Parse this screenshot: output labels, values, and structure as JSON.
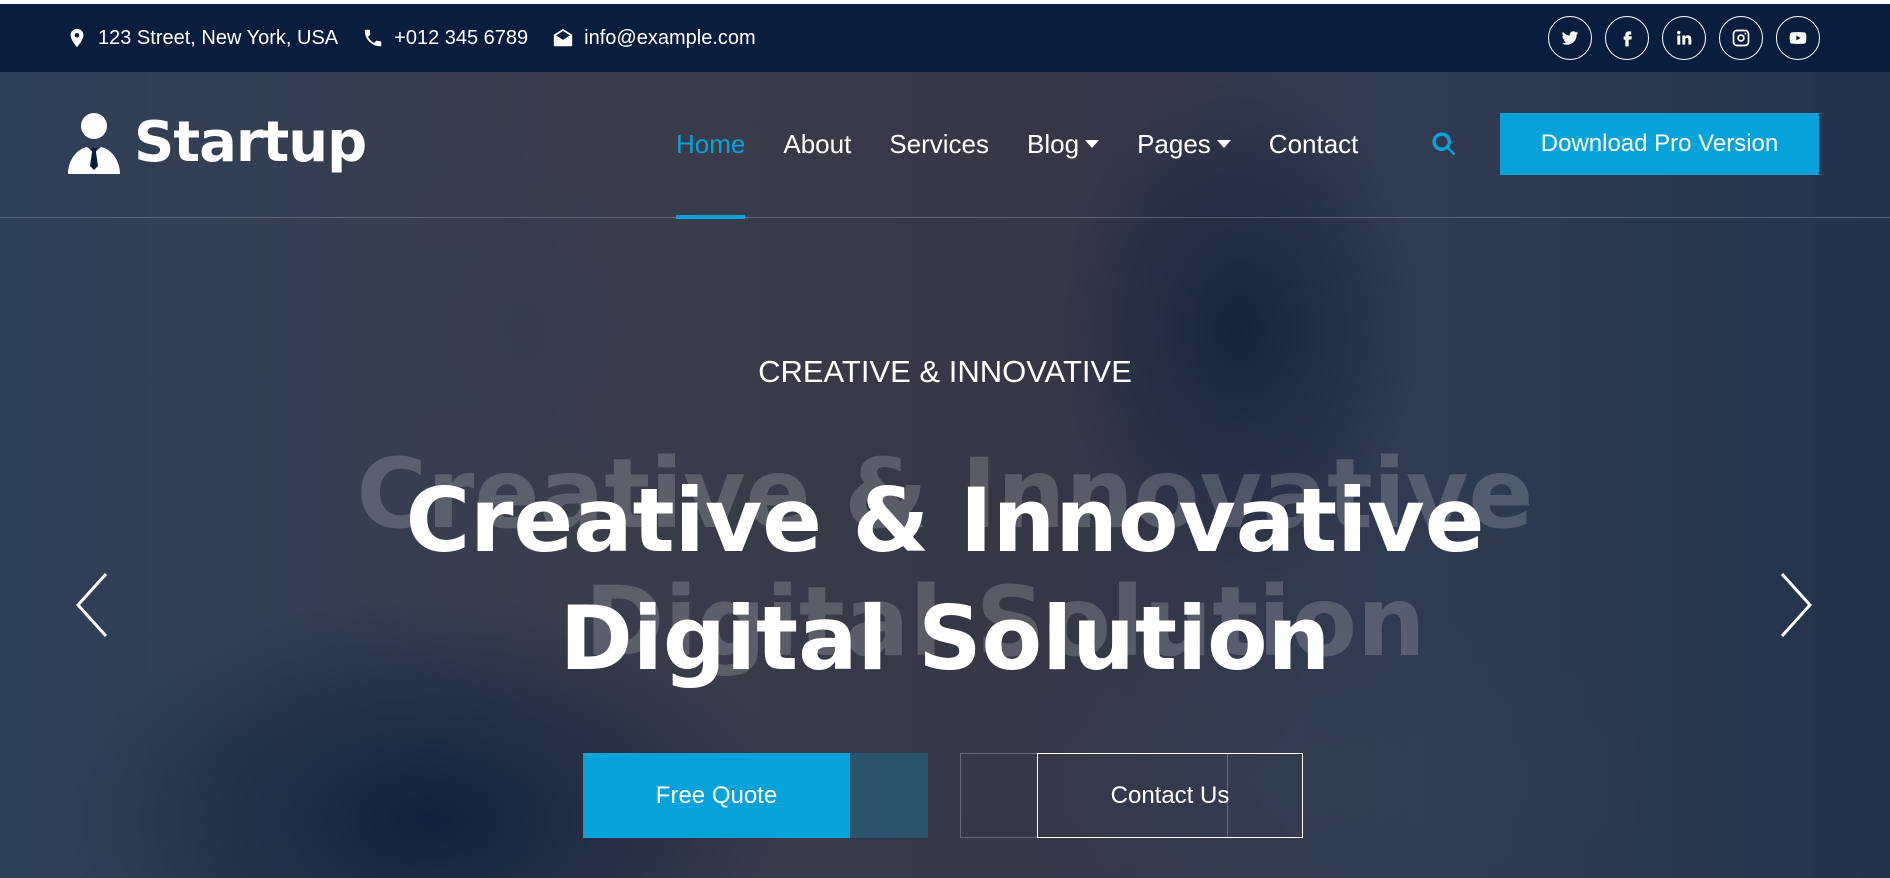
{
  "topbar": {
    "address": "123 Street, New York, USA",
    "phone": "+012 345 6789",
    "email": "info@example.com",
    "socials": [
      "twitter-icon",
      "facebook-icon",
      "linkedin-icon",
      "instagram-icon",
      "youtube-icon"
    ]
  },
  "brand": {
    "name": "Startup",
    "icon": "user-tie-icon"
  },
  "nav": {
    "items": [
      {
        "label": "Home",
        "active": true,
        "dropdown": false
      },
      {
        "label": "About",
        "active": false,
        "dropdown": false
      },
      {
        "label": "Services",
        "active": false,
        "dropdown": false
      },
      {
        "label": "Blog",
        "active": false,
        "dropdown": true
      },
      {
        "label": "Pages",
        "active": false,
        "dropdown": true
      },
      {
        "label": "Contact",
        "active": false,
        "dropdown": false
      }
    ],
    "cta_label": "Download Pro Version"
  },
  "hero": {
    "eyebrow": "CREATIVE & INNOVATIVE",
    "title_line1": "Creative & Innovative",
    "title_line2": "Digital Solution",
    "primary_button": "Free Quote",
    "secondary_button": "Contact Us"
  },
  "colors": {
    "accent": "#06a3da",
    "dark": "#091e3e",
    "text": "#ffffff"
  }
}
